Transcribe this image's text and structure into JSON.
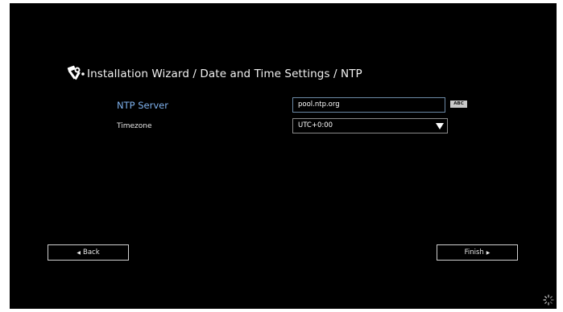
{
  "wizard": {
    "title": "Installation Wizard / Date and Time Settings / NTP",
    "icon": "wizard-tools-icon"
  },
  "form": {
    "ntp_label": "NTP Server",
    "ntp_value": "pool.ntp.org",
    "keyboard_mode": "ABC",
    "timezone_label": "Timezone",
    "timezone_value": "UTC+0:00"
  },
  "navigation": {
    "back_label": "Back",
    "finish_label": "Finish"
  },
  "colors": {
    "background": "#000000",
    "active_label": "#7fb2ee",
    "text": "#ffffff"
  }
}
